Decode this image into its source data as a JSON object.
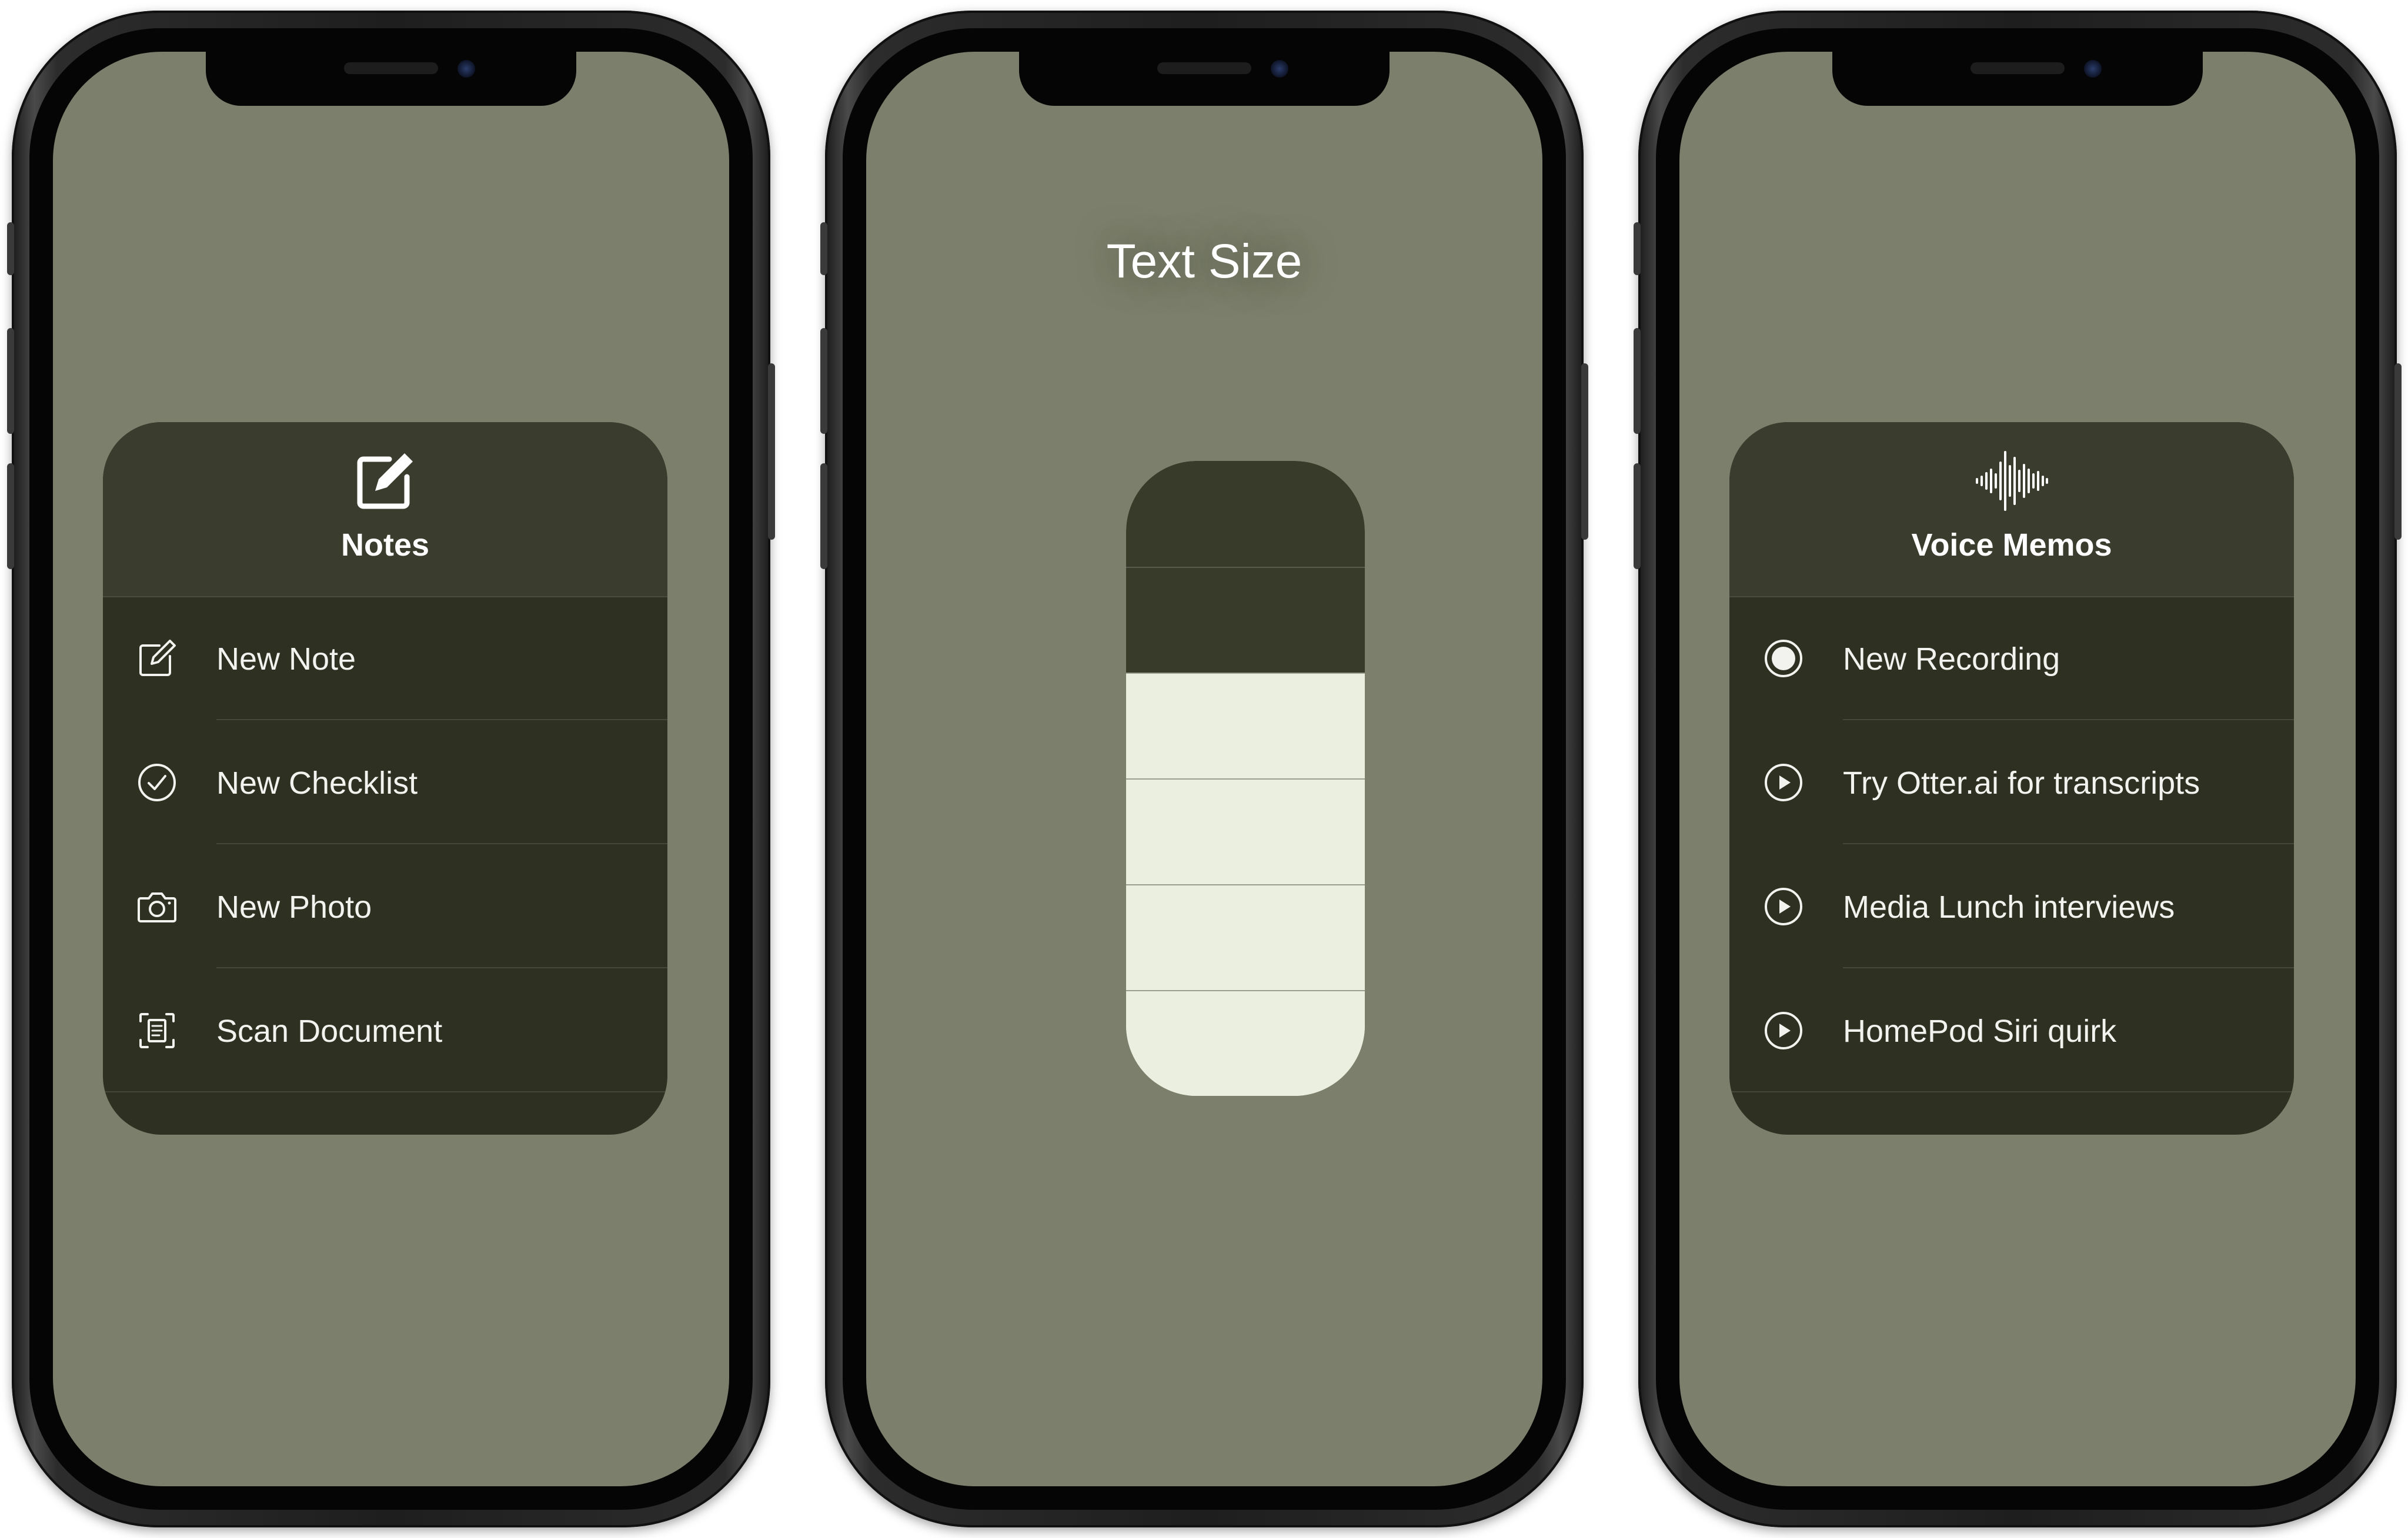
{
  "phones": {
    "notes": {
      "title": "Notes",
      "header_icon": "compose-icon",
      "items": [
        {
          "label": "New Note",
          "icon": "compose-icon"
        },
        {
          "label": "New Checklist",
          "icon": "checkmark-circle-icon"
        },
        {
          "label": "New Photo",
          "icon": "camera-icon"
        },
        {
          "label": "Scan Document",
          "icon": "scan-document-icon"
        }
      ]
    },
    "text_size": {
      "title": "Text Size",
      "level": 4,
      "max_level": 6
    },
    "voice_memos": {
      "title": "Voice Memos",
      "header_icon": "waveform-icon",
      "items": [
        {
          "label": "New Recording",
          "icon": "record-icon"
        },
        {
          "label": "Try Otter.ai for transcripts",
          "icon": "play-circle-icon"
        },
        {
          "label": "Media Lunch interviews",
          "icon": "play-circle-icon"
        },
        {
          "label": "HomePod Siri quirk",
          "icon": "play-circle-icon"
        }
      ]
    }
  },
  "colors": {
    "screen_bg": "#7b7f6b",
    "card_bg": "#2e3022",
    "slider_fill": "#ebefdf",
    "slider_empty": "#383a2a"
  }
}
